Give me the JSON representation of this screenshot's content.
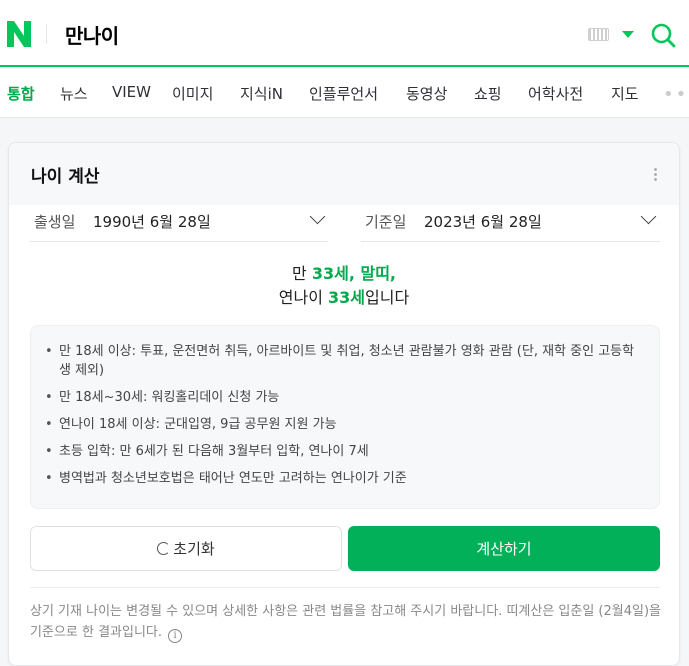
{
  "header": {
    "logo_letter": "N",
    "query": "만나이",
    "brand_color": "#03c75a"
  },
  "tabs": [
    {
      "label": "통합",
      "active": true
    },
    {
      "label": "뉴스"
    },
    {
      "label": "VIEW"
    },
    {
      "label": "이미지"
    },
    {
      "label": "지식iN"
    },
    {
      "label": "인플루언서"
    },
    {
      "label": "동영상"
    },
    {
      "label": "쇼핑"
    },
    {
      "label": "어학사전"
    },
    {
      "label": "지도"
    }
  ],
  "calculator": {
    "title": "나이 계산",
    "birth": {
      "label": "출생일",
      "value": "1990년 6월 28일"
    },
    "base": {
      "label": "기준일",
      "value": "2023년 6월 28일"
    },
    "result": {
      "line1_prefix": "만 ",
      "man_age": "33세",
      "sep": ", ",
      "zodiac": "말띠",
      "line1_suffix": ",",
      "line2_prefix": "연나이 ",
      "year_age": "33세",
      "line2_suffix": "입니다"
    },
    "notes": [
      "만 18세 이상: 투표, 운전면허 취득, 아르바이트 및 취업, 청소년 관람불가 영화 관람 (단, 재학 중인 고등학생 제외)",
      "만 18세~30세: 워킹홀리데이 신청 가능",
      "연나이 18세 이상: 군대입영, 9급 공무원 지원 가능",
      "초등 입학: 만 6세가 된 다음해 3월부터 입학, 연나이 7세",
      "병역법과 청소년보호법은 태어난 연도만 고려하는 연나이가 기준"
    ],
    "reset_label": "초기화",
    "calc_label": "계산하기",
    "disclaimer": "상기 기재 나이는 변경될 수 있으며 상세한 사항은 관련 법률을 참고해 주시기 바랍니다. 띠계산은 입춘일 (2월4일)을 기준으로 한 결과입니다.",
    "info_glyph": "i"
  }
}
